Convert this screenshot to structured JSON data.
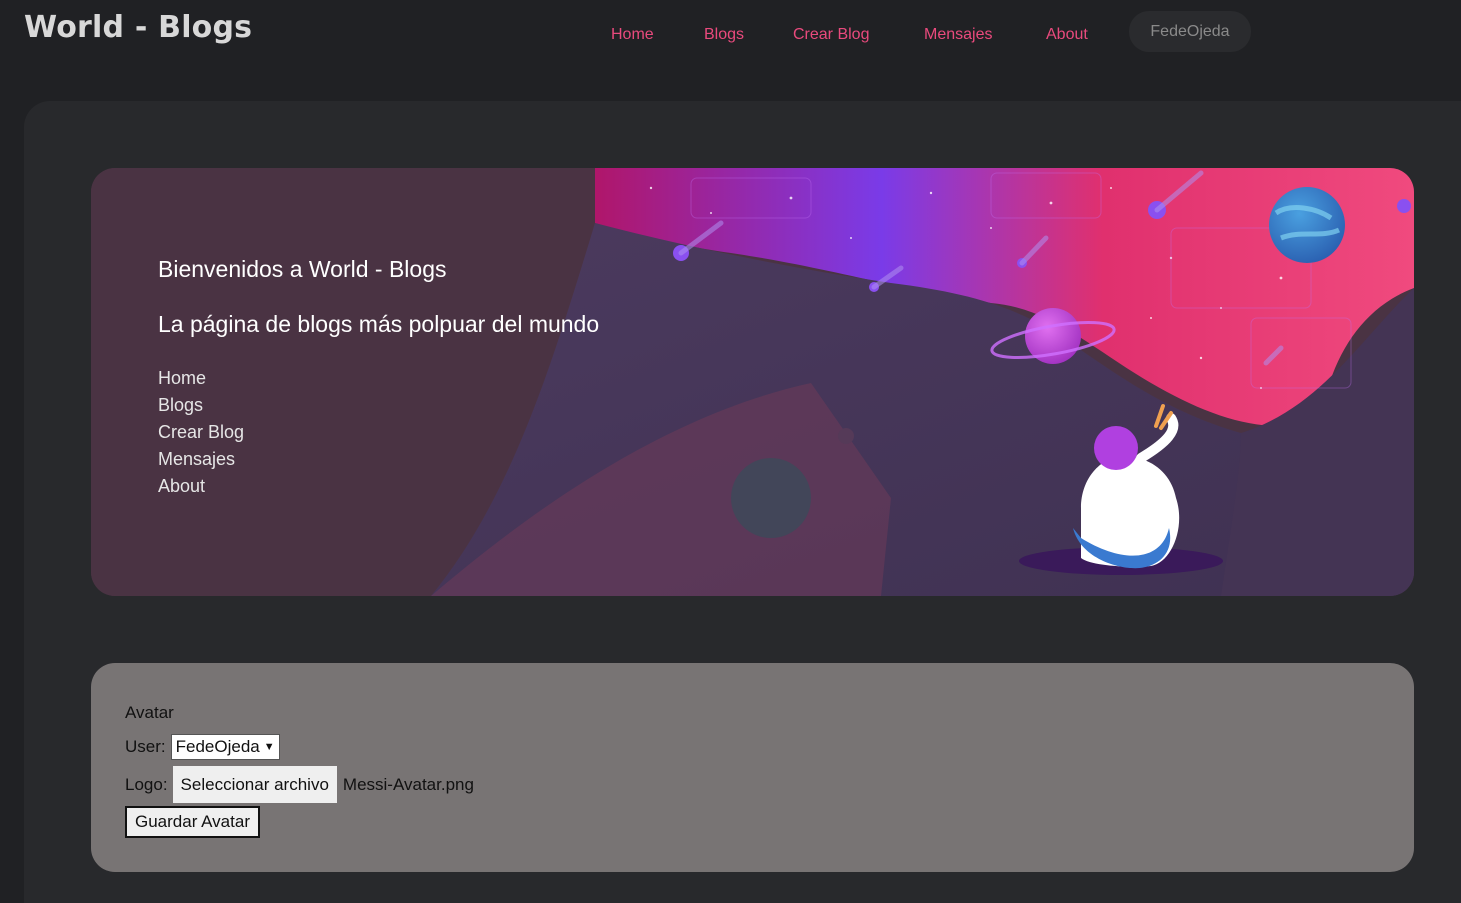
{
  "header": {
    "brand": "World - Blogs",
    "nav": [
      "Home",
      "Blogs",
      "Crear Blog",
      "Mensajes",
      "About"
    ],
    "user": "FedeOjeda"
  },
  "hero": {
    "title": "Bienvenidos a World - Blogs",
    "subtitle": "La página de blogs más polpuar del mundo",
    "links": [
      "Home",
      "Blogs",
      "Crear Blog",
      "Mensajes",
      "About"
    ]
  },
  "avatar_form": {
    "heading": "Avatar",
    "user_label": "User:",
    "user_value": "FedeOjeda",
    "logo_label": "Logo:",
    "file_button": "Seleccionar archivo",
    "file_name": "Messi-Avatar.png",
    "save_button": "Guardar Avatar"
  },
  "colors": {
    "accent": "#e94a7d",
    "page_bg": "#202124",
    "panel_bg": "#28292c",
    "form_bg": "#787474"
  }
}
